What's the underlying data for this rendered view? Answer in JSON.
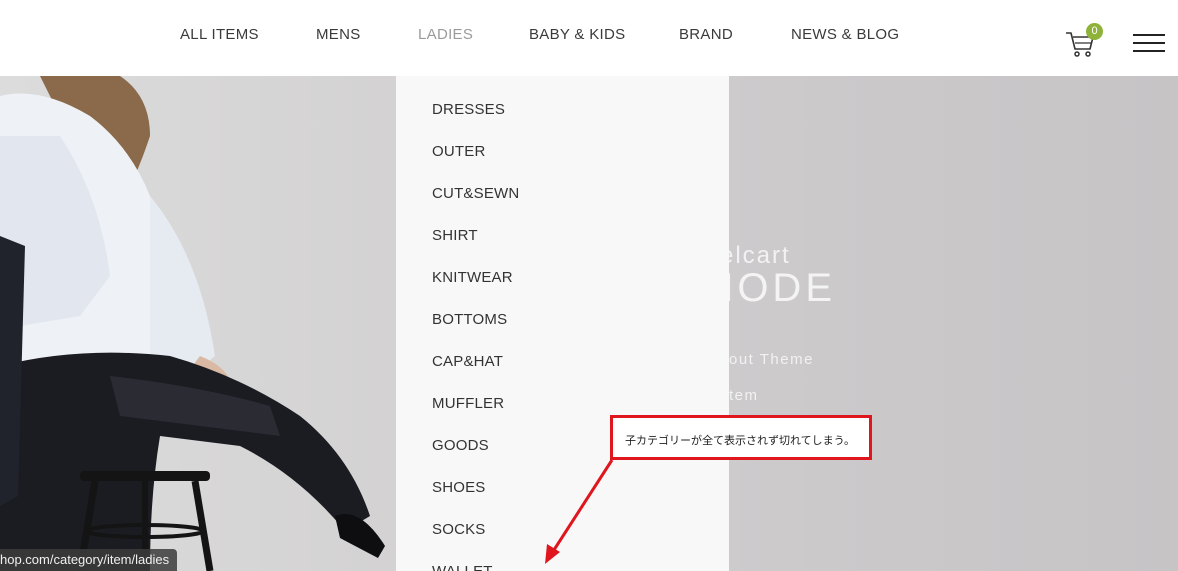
{
  "nav": {
    "items": [
      {
        "label": "ALL ITEMS"
      },
      {
        "label": "MENS"
      },
      {
        "label": "LADIES"
      },
      {
        "label": "BABY & KIDS"
      },
      {
        "label": "BRAND"
      },
      {
        "label": "NEWS & BLOG"
      }
    ],
    "active_index": 2,
    "cart_count": "0",
    "cart_icon": "cart-icon",
    "menu_icon": "hamburger-menu-icon",
    "colors": {
      "badge": "#8fb23a",
      "text": "#3a3a3a",
      "active": "#9b9b9b"
    }
  },
  "dropdown": {
    "items": [
      {
        "label": "DRESSES"
      },
      {
        "label": "OUTER"
      },
      {
        "label": "CUT&SEWN"
      },
      {
        "label": "SHIRT"
      },
      {
        "label": "KNITWEAR"
      },
      {
        "label": "BOTTOMS"
      },
      {
        "label": "CAP&HAT"
      },
      {
        "label": "MUFFLER"
      },
      {
        "label": "GOODS"
      },
      {
        "label": "SHOES"
      },
      {
        "label": "SOCKS"
      },
      {
        "label": "WALLET"
      }
    ]
  },
  "hero": {
    "brand_partial": "elcart",
    "title_partial": "MODE",
    "sub1_partial": "yout Theme",
    "sub2_partial": "stem"
  },
  "annotation": {
    "text": "子カテゴリーが全て表示されず切れてしまう。",
    "color": "#e0161e"
  },
  "status_bar": {
    "url": "hop.com/category/item/ladies"
  }
}
